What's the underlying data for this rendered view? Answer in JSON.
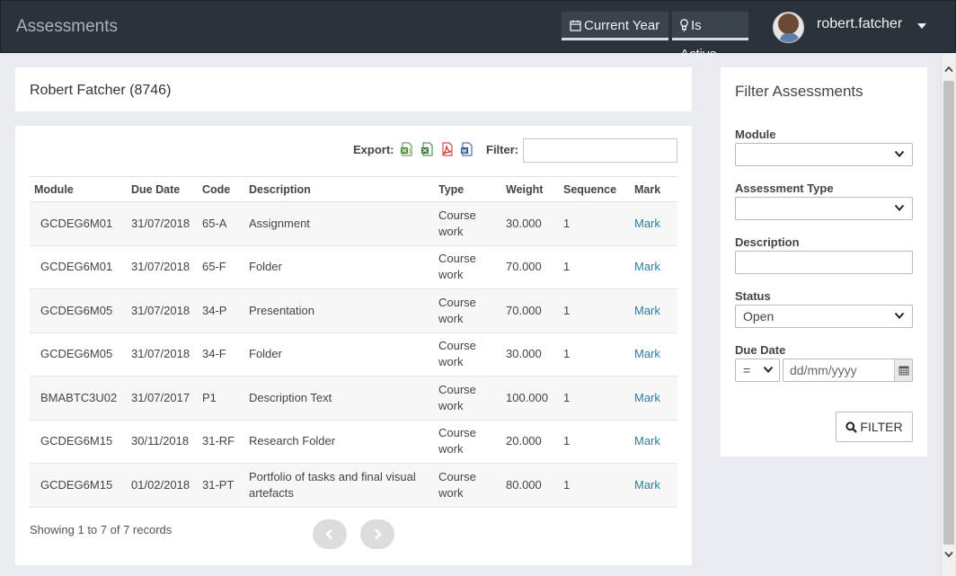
{
  "header": {
    "app_title": "Assessments",
    "chips": [
      {
        "label": "Current Year",
        "icon": "calendar-icon"
      },
      {
        "label": "Is Active",
        "icon": "lightbulb-icon"
      }
    ],
    "username": "robert.fatcher"
  },
  "student": {
    "name": "Robert Fatcher (8746)"
  },
  "toolbar": {
    "export_label": "Export:",
    "export_icons": [
      "excel-csv-icon",
      "excel-icon",
      "pdf-icon",
      "word-icon"
    ],
    "filter_label": "Filter:",
    "filter_value": ""
  },
  "table": {
    "columns": [
      "Module",
      "Due Date",
      "Code",
      "Description",
      "Type",
      "Weight",
      "Sequence",
      "Mark"
    ],
    "rows": [
      {
        "module": "GCDEG6M01",
        "due_date": "31/07/2018",
        "code": "65-A",
        "description": "Assignment",
        "type": "Course work",
        "weight": "30.000",
        "sequence": "1",
        "mark": "Mark"
      },
      {
        "module": "GCDEG6M01",
        "due_date": "31/07/2018",
        "code": "65-F",
        "description": "Folder",
        "type": "Course work",
        "weight": "70.000",
        "sequence": "1",
        "mark": "Mark"
      },
      {
        "module": "GCDEG6M05",
        "due_date": "31/07/2018",
        "code": "34-P",
        "description": "Presentation",
        "type": "Course work",
        "weight": "70.000",
        "sequence": "1",
        "mark": "Mark"
      },
      {
        "module": "GCDEG6M05",
        "due_date": "31/07/2018",
        "code": "34-F",
        "description": "Folder",
        "type": "Course work",
        "weight": "30.000",
        "sequence": "1",
        "mark": "Mark"
      },
      {
        "module": "BMABTC3U02",
        "due_date": "31/07/2017",
        "code": "P1",
        "description": "Description Text",
        "type": "Course work",
        "weight": "100.000",
        "sequence": "1",
        "mark": "Mark"
      },
      {
        "module": "GCDEG6M15",
        "due_date": "30/11/2018",
        "code": "31-RF",
        "description": "Research Folder",
        "type": "Course work",
        "weight": "20.000",
        "sequence": "1",
        "mark": "Mark"
      },
      {
        "module": "GCDEG6M15",
        "due_date": "01/02/2018",
        "code": "31-PT",
        "description": "Portfolio of tasks and final visual artefacts",
        "type": "Course work",
        "weight": "80.000",
        "sequence": "1",
        "mark": "Mark"
      }
    ]
  },
  "pagination": {
    "info": "Showing 1 to 7 of 7 records"
  },
  "filter_panel": {
    "title": "Filter Assessments",
    "module_label": "Module",
    "module_value": "",
    "assessment_type_label": "Assessment Type",
    "assessment_type_value": "",
    "description_label": "Description",
    "description_value": "",
    "status_label": "Status",
    "status_value": "Open",
    "due_date_label": "Due Date",
    "due_date_operator": "=",
    "due_date_placeholder": "dd/mm/yyyy",
    "filter_button_label": "FILTER"
  },
  "colors": {
    "topbar_bg": "#2b323a",
    "link": "#2a7fa0",
    "page_bg": "#e8ebef"
  }
}
